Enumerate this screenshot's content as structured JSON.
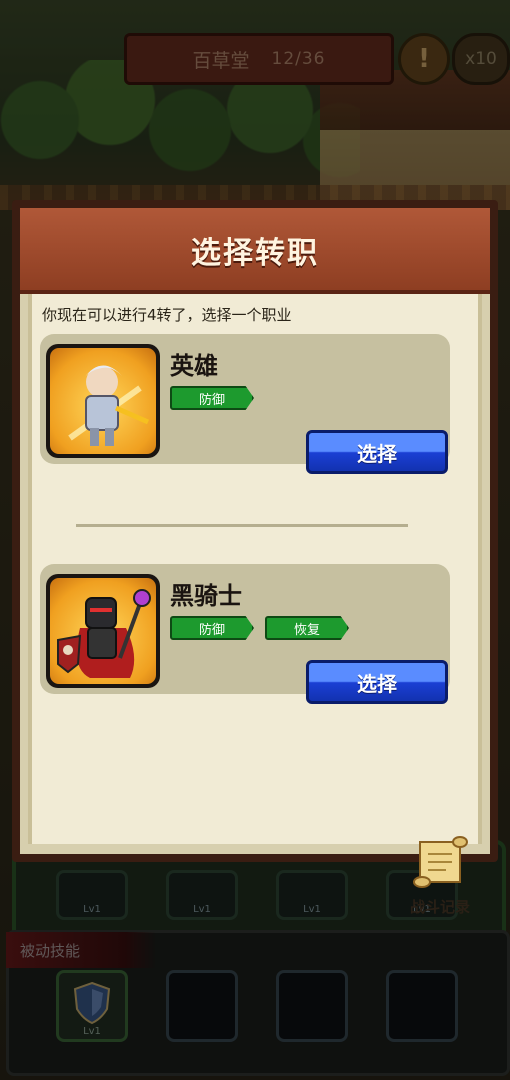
{
  "hud": {
    "location": "百草堂",
    "progress": "12/36",
    "hint_icon": "!",
    "multiplier": "x10"
  },
  "dialog": {
    "title": "选择转职",
    "instruction": "你现在可以进行4转了，选择一个职业",
    "jobs": [
      {
        "name": "英雄",
        "tags": [
          "防御"
        ],
        "select_label": "选择",
        "portrait": "hero-knight-portrait"
      },
      {
        "name": "黑骑士",
        "tags": [
          "防御",
          "恢复"
        ],
        "select_label": "选择",
        "portrait": "dark-knight-portrait"
      }
    ],
    "record_label": "战斗记录"
  },
  "skills": {
    "top_slot_levels": [
      "Lv1",
      "Lv1",
      "Lv1",
      "Lv1"
    ],
    "passive_label": "被动技能",
    "passive_slots": [
      {
        "level": "Lv1"
      },
      {
        "level": ""
      },
      {
        "level": ""
      },
      {
        "level": ""
      }
    ]
  }
}
